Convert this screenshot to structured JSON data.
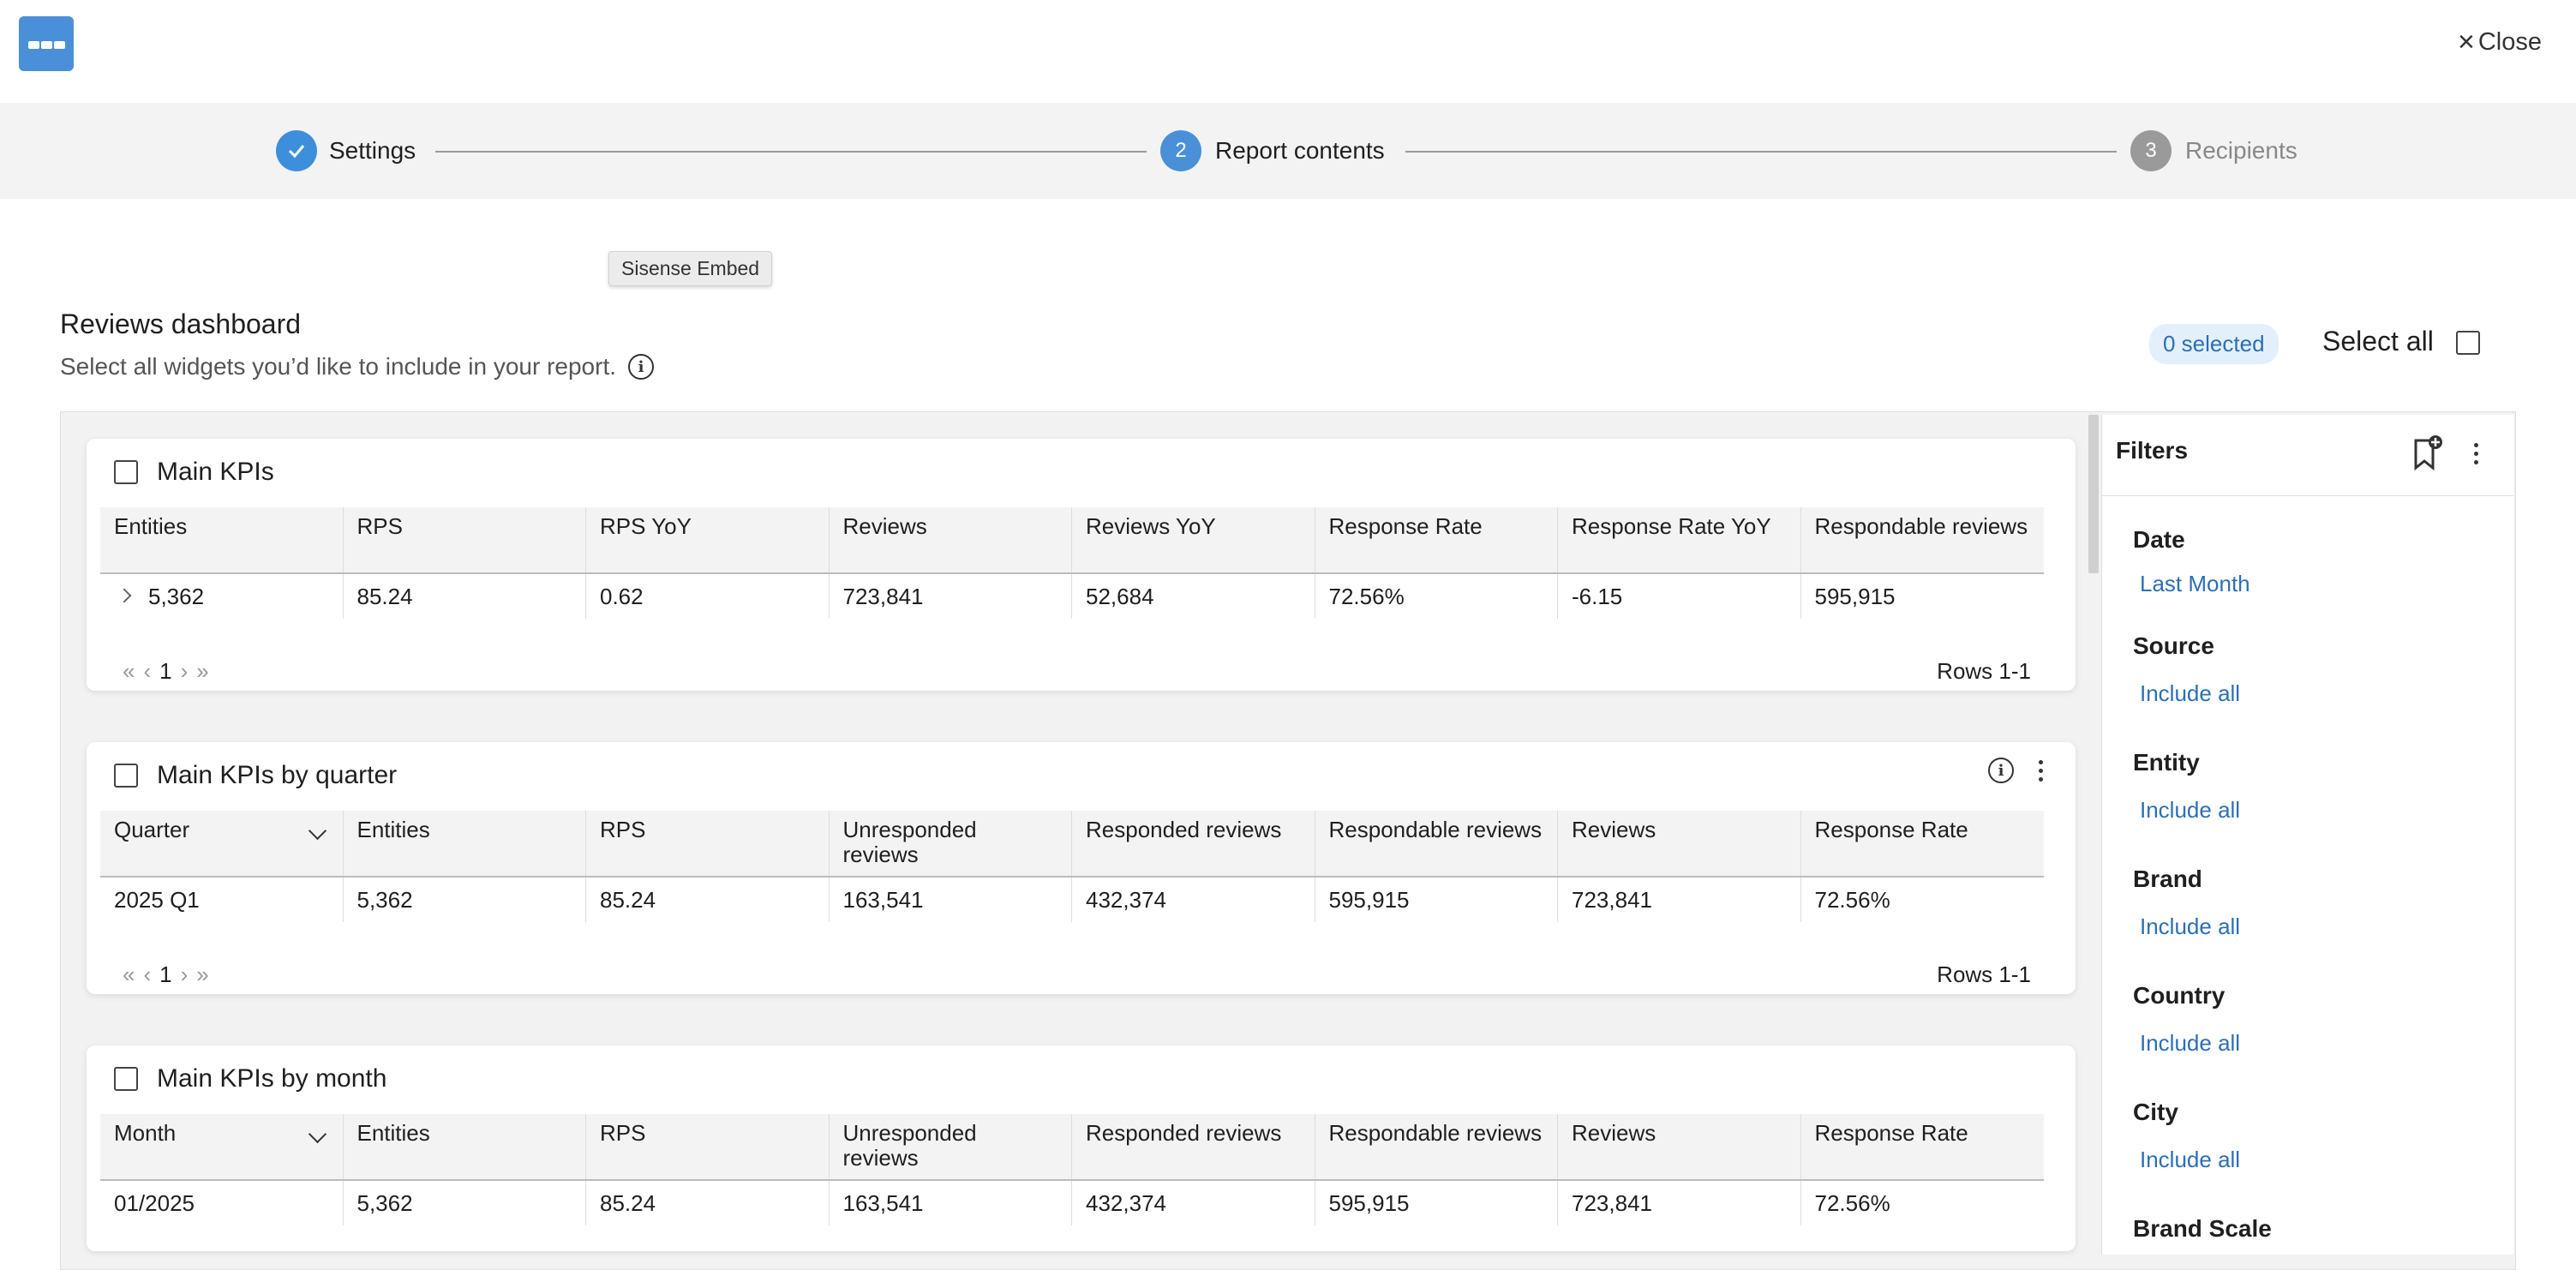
{
  "header": {
    "close_label": "Close"
  },
  "stepper": {
    "steps": [
      {
        "number": "",
        "label": "Settings",
        "state": "done"
      },
      {
        "number": "2",
        "label": "Report contents",
        "state": "active"
      },
      {
        "number": "3",
        "label": "Recipients",
        "state": "pending"
      }
    ]
  },
  "tooltip": {
    "text": "Sisense Embed"
  },
  "dashboard": {
    "title": "Reviews dashboard",
    "subtitle": "Select all widgets you’d like to include in your report.",
    "selected_badge": "0 selected",
    "select_all_label": "Select all"
  },
  "widgets": [
    {
      "title": "Main KPIs",
      "columns": [
        "Entities",
        "RPS",
        "RPS YoY",
        "Reviews",
        "Reviews YoY",
        "Response Rate",
        "Response Rate YoY",
        "Respondable reviews"
      ],
      "rows": [
        [
          "5,362",
          "85.24",
          "0.62",
          "723,841",
          "52,684",
          "72.56%",
          "-6.15",
          "595,915"
        ]
      ],
      "page": "1",
      "rows_label": "Rows 1-1"
    },
    {
      "title": "Main KPIs by quarter",
      "columns": [
        "Quarter",
        "Entities",
        "RPS",
        "Unresponded reviews",
        "Responded reviews",
        "Respondable reviews",
        "Reviews",
        "Response Rate"
      ],
      "rows": [
        [
          "2025 Q1",
          "5,362",
          "85.24",
          "163,541",
          "432,374",
          "595,915",
          "723,841",
          "72.56%"
        ]
      ],
      "page": "1",
      "rows_label": "Rows 1-1"
    },
    {
      "title": "Main KPIs by month",
      "columns": [
        "Month",
        "Entities",
        "RPS",
        "Unresponded reviews",
        "Responded reviews",
        "Respondable reviews",
        "Reviews",
        "Response Rate"
      ],
      "rows": [
        [
          "01/2025",
          "5,362",
          "85.24",
          "163,541",
          "432,374",
          "595,915",
          "723,841",
          "72.56%"
        ]
      ]
    }
  ],
  "filters": {
    "title": "Filters",
    "items": [
      {
        "label": "Date",
        "value": "Last Month"
      },
      {
        "label": "Source",
        "value": "Include all"
      },
      {
        "label": "Entity",
        "value": "Include all"
      },
      {
        "label": "Brand",
        "value": "Include all"
      },
      {
        "label": "Country",
        "value": "Include all"
      },
      {
        "label": "City",
        "value": "Include all"
      },
      {
        "label": "Brand Scale",
        "value": ""
      }
    ]
  },
  "colors": {
    "accent": "#4a90d9",
    "link": "#2b6fb6",
    "done": "#3d8fdc",
    "pending": "#9a9a9a"
  }
}
